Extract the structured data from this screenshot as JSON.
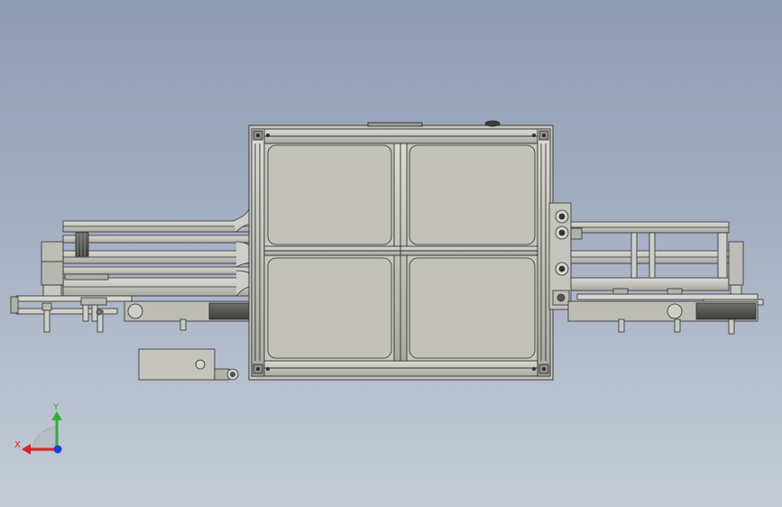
{
  "view": {
    "background_top": "#8f9db4",
    "background_bottom": "#c5ccd8",
    "part_fill": "#c9c9c3",
    "panel_fill": "#c2c2bb",
    "edge_color": "#2e2e2e"
  },
  "triad": {
    "x_label": "X",
    "y_label": "Y",
    "x_color": "#d8232a",
    "y_color": "#2fae3a",
    "z_color": "#1f3fd0"
  }
}
